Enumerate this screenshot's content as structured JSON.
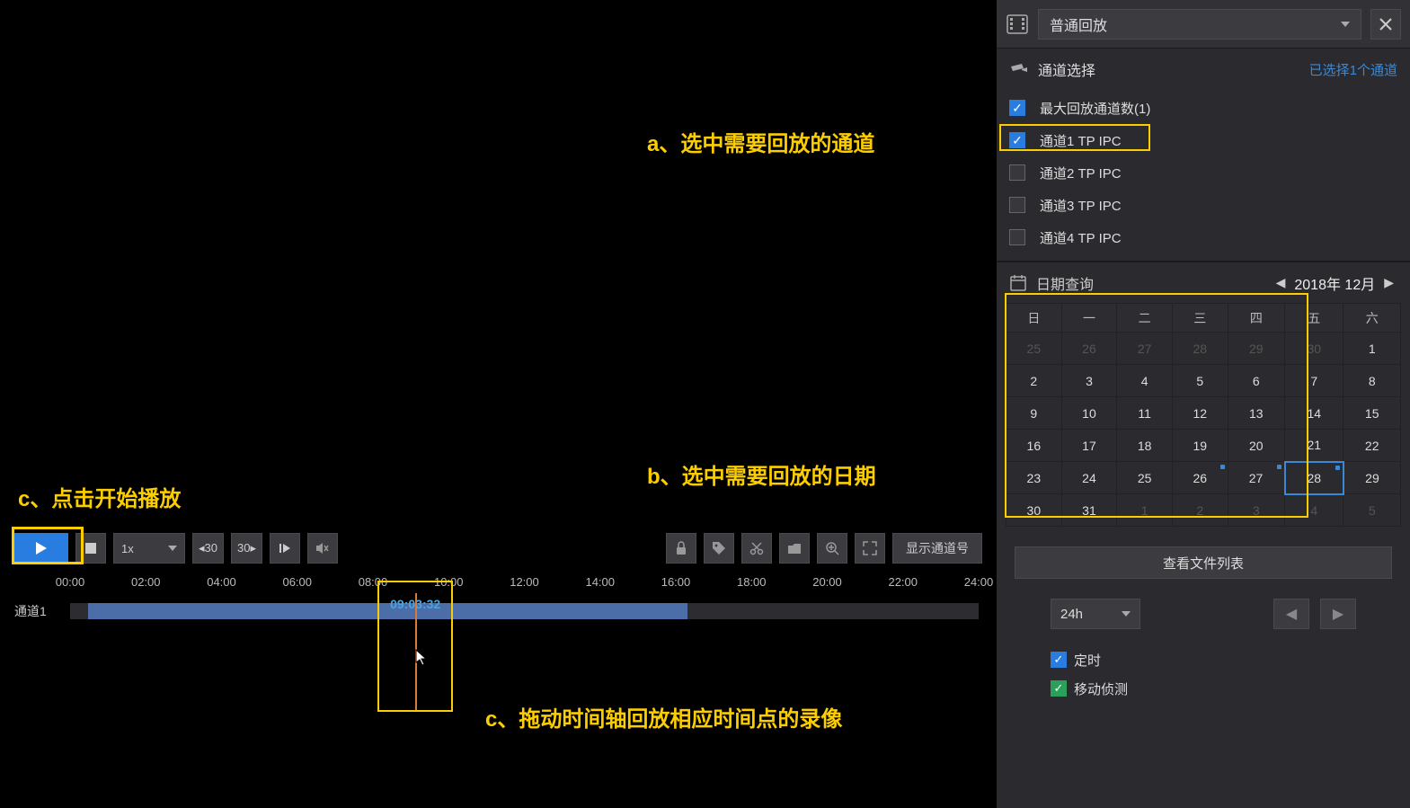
{
  "annotations": {
    "a": "a、选中需要回放的通道",
    "b": "b、选中需要回放的日期",
    "c1": "c、点击开始播放",
    "c2": "c、拖动时间轴回放相应时间点的录像"
  },
  "header": {
    "playback_mode": "普通回放"
  },
  "channel_section": {
    "title": "通道选择",
    "selected_count": "已选择1个通道",
    "max_label": "最大回放通道数(1)",
    "items": [
      {
        "label": "通道1 TP IPC",
        "checked": true
      },
      {
        "label": "通道2 TP IPC",
        "checked": false
      },
      {
        "label": "通道3 TP IPC",
        "checked": false
      },
      {
        "label": "通道4 TP IPC",
        "checked": false
      }
    ]
  },
  "calendar": {
    "title": "日期查询",
    "month": "2018年 12月",
    "dow": [
      "日",
      "一",
      "二",
      "三",
      "四",
      "五",
      "六"
    ],
    "weeks": [
      [
        {
          "d": "25",
          "dim": true
        },
        {
          "d": "26",
          "dim": true
        },
        {
          "d": "27",
          "dim": true
        },
        {
          "d": "28",
          "dim": true
        },
        {
          "d": "29",
          "dim": true
        },
        {
          "d": "30",
          "dim": true
        },
        {
          "d": "1"
        }
      ],
      [
        {
          "d": "2"
        },
        {
          "d": "3"
        },
        {
          "d": "4"
        },
        {
          "d": "5"
        },
        {
          "d": "6"
        },
        {
          "d": "7"
        },
        {
          "d": "8"
        }
      ],
      [
        {
          "d": "9"
        },
        {
          "d": "10"
        },
        {
          "d": "11"
        },
        {
          "d": "12"
        },
        {
          "d": "13"
        },
        {
          "d": "14"
        },
        {
          "d": "15"
        }
      ],
      [
        {
          "d": "16"
        },
        {
          "d": "17"
        },
        {
          "d": "18"
        },
        {
          "d": "19"
        },
        {
          "d": "20"
        },
        {
          "d": "21"
        },
        {
          "d": "22"
        }
      ],
      [
        {
          "d": "23"
        },
        {
          "d": "24"
        },
        {
          "d": "25"
        },
        {
          "d": "26",
          "dot": true
        },
        {
          "d": "27",
          "dot": true
        },
        {
          "d": "28",
          "dot": true,
          "selected": true
        },
        {
          "d": "29"
        }
      ],
      [
        {
          "d": "30"
        },
        {
          "d": "31"
        },
        {
          "d": "1",
          "dim": true
        },
        {
          "d": "2",
          "dim": true
        },
        {
          "d": "3",
          "dim": true
        },
        {
          "d": "4",
          "dim": true
        },
        {
          "d": "5",
          "dim": true
        }
      ]
    ]
  },
  "file_list_btn": "查看文件列表",
  "range": "24h",
  "legend": {
    "scheduled": "定时",
    "motion": "移动侦测"
  },
  "toolbar": {
    "speed": "1x",
    "back30": "◂30",
    "fwd30": "30▸",
    "show_channel": "显示通道号"
  },
  "timeline": {
    "ticks": [
      "00:00",
      "02:00",
      "04:00",
      "06:00",
      "08:00",
      "10:00",
      "12:00",
      "14:00",
      "16:00",
      "18:00",
      "20:00",
      "22:00",
      "24:00"
    ],
    "track_label": "通道1",
    "segment": {
      "start_pct": 2,
      "end_pct": 68
    },
    "playhead_time": "09:03:32",
    "playhead_pct": 38
  }
}
